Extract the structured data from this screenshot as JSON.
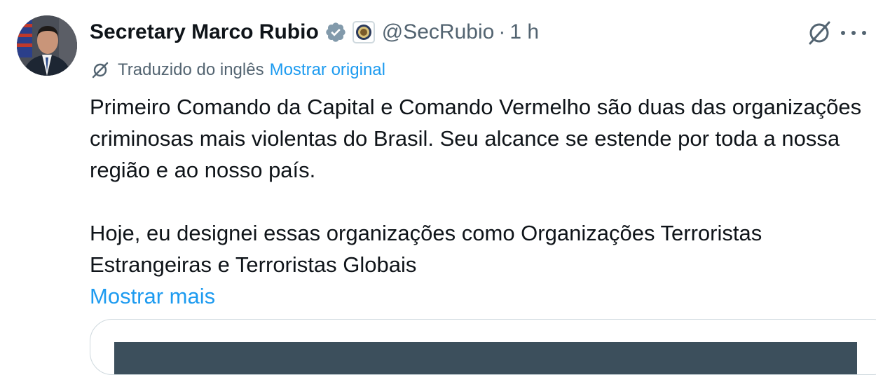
{
  "author": {
    "name": "Secretary Marco Rubio",
    "handle": "@SecRubio",
    "separator": "·",
    "time": "1 h"
  },
  "translation": {
    "label": "Traduzido do inglês",
    "show_original": "Mostrar original"
  },
  "body": {
    "paragraph1": "Primeiro Comando da Capital e Comando Vermelho são duas das organizações criminosas mais violentas do Brasil. Seu alcance se estende por toda a nossa região e ao nosso país.",
    "paragraph2": "Hoje, eu designei essas organizações como Organizações Terroristas Estrangeiras e Terroristas Globais",
    "show_more": "Mostrar mais"
  },
  "icons": {
    "verified": "verified-badge-icon",
    "affiliation": "government-seal-icon",
    "grok": "grok-icon",
    "more": "more-options-icon",
    "translate": "translate-icon"
  },
  "colors": {
    "link": "#1d9bf0",
    "secondary_text": "#536471",
    "primary_text": "#0f1419",
    "verified_badge": "#829aab",
    "card_border": "#cfd9de"
  }
}
